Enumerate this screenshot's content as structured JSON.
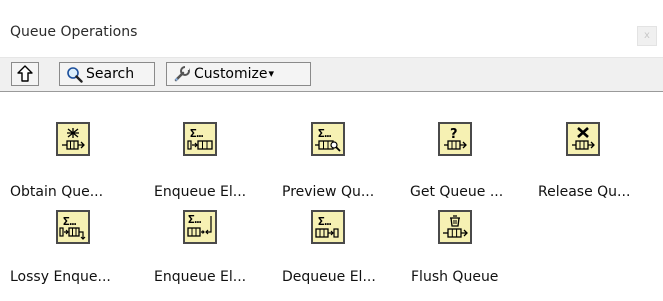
{
  "window": {
    "title": "Queue Operations",
    "close_glyph": "x"
  },
  "toolbar": {
    "up_icon": "up-arrow-icon",
    "search_label": "Search",
    "search_icon": "magnifier-icon",
    "customize_label": "Customize",
    "customize_icon": "wrench-icon",
    "dropdown_glyph": "▾"
  },
  "palette": {
    "items": [
      {
        "label": "Obtain Que...",
        "icon": "obtain-queue-icon"
      },
      {
        "label": "Enqueue El...",
        "icon": "enqueue-element-icon"
      },
      {
        "label": "Preview Qu...",
        "icon": "preview-queue-element-icon"
      },
      {
        "label": "Get Queue ...",
        "icon": "get-queue-status-icon"
      },
      {
        "label": "Release Qu...",
        "icon": "release-queue-icon"
      },
      {
        "label": "Lossy Enque...",
        "icon": "lossy-enqueue-element-icon"
      },
      {
        "label": "Enqueue El...",
        "icon": "enqueue-element-at-opposite-end-icon"
      },
      {
        "label": "Dequeue El...",
        "icon": "dequeue-element-icon"
      },
      {
        "label": "Flush Queue",
        "icon": "flush-queue-icon"
      }
    ]
  }
}
